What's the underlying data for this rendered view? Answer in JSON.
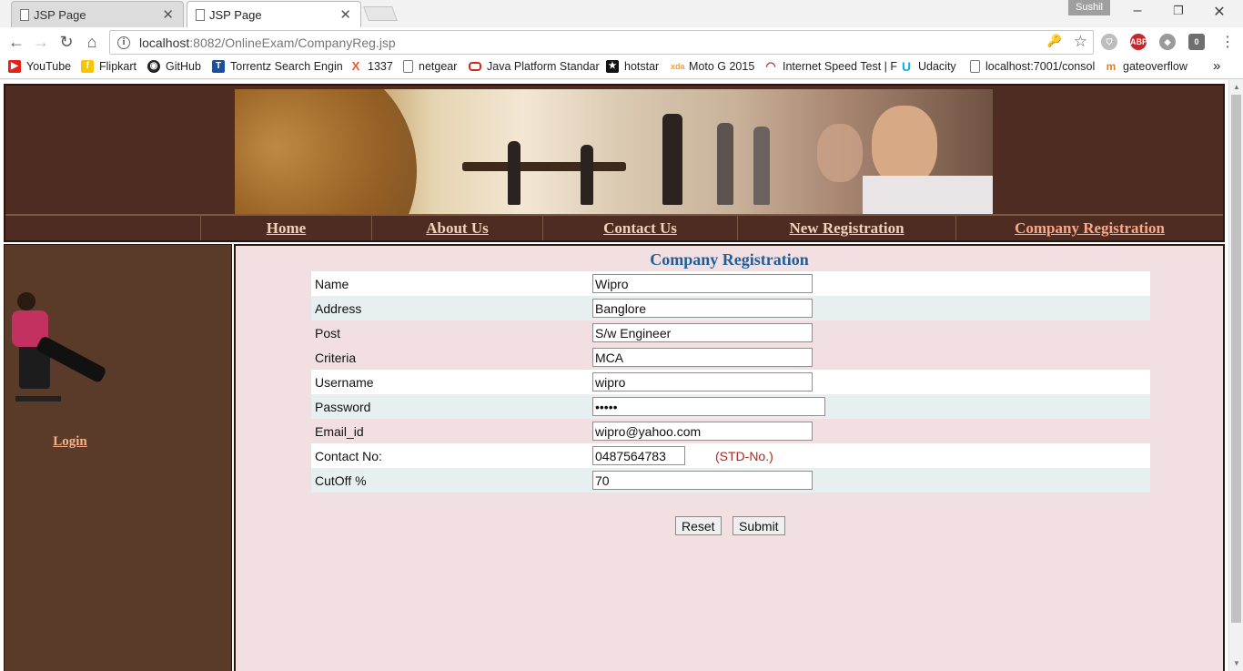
{
  "browser": {
    "tabs": [
      {
        "title": "JSP Page",
        "active": false
      },
      {
        "title": "JSP Page",
        "active": true
      }
    ],
    "user_name": "Sushil",
    "url_host": "localhost",
    "url_path": ":8082/OnlineExam/CompanyReg.jsp",
    "bookmarks": [
      {
        "label": "YouTube",
        "icon": "youtube-icon",
        "color": "#e62117"
      },
      {
        "label": "Flipkart",
        "icon": "flipkart-icon",
        "color": "#f7c600"
      },
      {
        "label": "GitHub",
        "icon": "github-icon",
        "color": "#222222"
      },
      {
        "label": "Torrentz Search Engin",
        "icon": "torrentz-icon",
        "color": "#1a4f9c"
      },
      {
        "label": "1337",
        "icon": "x-icon",
        "color": "#e3592c"
      },
      {
        "label": "netgear",
        "icon": "page-icon",
        "color": "#ffffff"
      },
      {
        "label": "Java Platform Standar",
        "icon": "oracle-icon",
        "color": "#d8261c"
      },
      {
        "label": "hotstar",
        "icon": "hotstar-icon",
        "color": "#111111"
      },
      {
        "label": "Moto G 2015",
        "icon": "xda-icon",
        "color": "#f29c3a"
      },
      {
        "label": "Internet Speed Test | F",
        "icon": "speedtest-icon",
        "color": "#c0392b"
      },
      {
        "label": "Udacity",
        "icon": "udacity-icon",
        "color": "#02b3e4"
      },
      {
        "label": "localhost:7001/consol",
        "icon": "page-icon",
        "color": "#ffffff"
      },
      {
        "label": "gateoverflow",
        "icon": "gateoverflow-icon",
        "color": "#e67e22"
      }
    ]
  },
  "site": {
    "menu": [
      {
        "label": "Home",
        "active": false
      },
      {
        "label": "About Us",
        "active": false
      },
      {
        "label": "Contact Us",
        "active": false
      },
      {
        "label": "New Registration",
        "active": false
      },
      {
        "label": "Company Registration",
        "active": true
      }
    ],
    "login_link": "Login"
  },
  "form": {
    "title": "Company Registration",
    "fields": [
      {
        "label": "Name",
        "value": "Wipro"
      },
      {
        "label": "Address",
        "value": "Banglore"
      },
      {
        "label": "Post",
        "value": "S/w Engineer"
      },
      {
        "label": "Criteria",
        "value": "MCA"
      },
      {
        "label": "Username",
        "value": "wipro"
      },
      {
        "label": "Password",
        "value": "•••••"
      },
      {
        "label": "Email_id",
        "value": "wipro@yahoo.com"
      },
      {
        "label": "Contact No:",
        "value": "0487564783",
        "note": "(STD-No.)"
      },
      {
        "label": "CutOff %",
        "value": "70"
      }
    ],
    "reset_label": "Reset",
    "submit_label": "Submit"
  }
}
